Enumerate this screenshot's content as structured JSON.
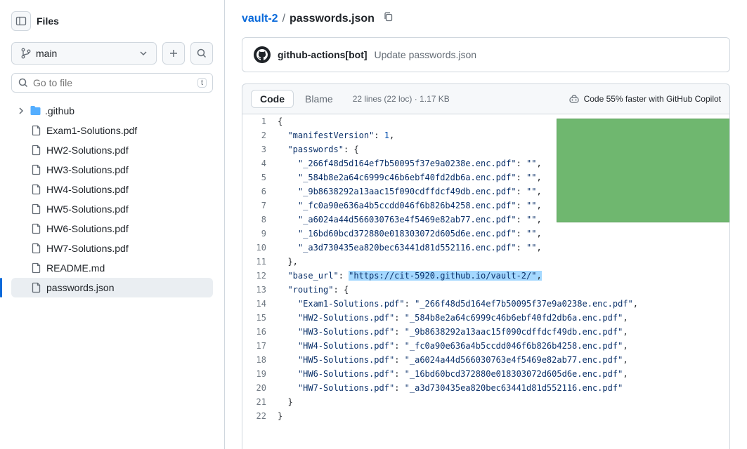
{
  "sidebar": {
    "title": "Files",
    "branch": "main",
    "searchPlaceholder": "Go to file",
    "searchKbd": "t",
    "tree": {
      "folder": ".github",
      "files": [
        "Exam1-Solutions.pdf",
        "HW2-Solutions.pdf",
        "HW3-Solutions.pdf",
        "HW4-Solutions.pdf",
        "HW5-Solutions.pdf",
        "HW6-Solutions.pdf",
        "HW7-Solutions.pdf",
        "README.md",
        "passwords.json"
      ],
      "selected": "passwords.json"
    }
  },
  "breadcrumb": {
    "repo": "vault-2",
    "file": "passwords.json"
  },
  "commit": {
    "author": "github-actions[bot]",
    "message": "Update passwords.json"
  },
  "toolbar": {
    "codeTab": "Code",
    "blameTab": "Blame",
    "meta": "22 lines (22 loc) · 1.17 KB",
    "copilot": "Code 55% faster with GitHub Copilot"
  },
  "code": {
    "manifestVersion": 1,
    "base_url": "https://cit-5920.github.io/vault-2/",
    "passwords": [
      {
        "key": "_266f48d5d164ef7b50095f37e9a0238e.enc.pdf",
        "val": ""
      },
      {
        "key": "_584b8e2a64c6999c46b6ebf40fd2db6a.enc.pdf",
        "val": ""
      },
      {
        "key": "_9b8638292a13aac15f090cdffdcf49db.enc.pdf",
        "val": ""
      },
      {
        "key": "_fc0a90e636a4b5ccdd046f6b826b4258.enc.pdf",
        "val": ""
      },
      {
        "key": "_a6024a44d566030763e4f5469e82ab77.enc.pdf",
        "val": ""
      },
      {
        "key": "_16bd60bcd372880e018303072d605d6e.enc.pdf",
        "val": ""
      },
      {
        "key": "_a3d730435ea820bec63441d81d552116.enc.pdf",
        "val": ""
      }
    ],
    "routing": [
      {
        "key": "Exam1-Solutions.pdf",
        "val": "_266f48d5d164ef7b50095f37e9a0238e.enc.pdf"
      },
      {
        "key": "HW2-Solutions.pdf",
        "val": "_584b8e2a64c6999c46b6ebf40fd2db6a.enc.pdf"
      },
      {
        "key": "HW3-Solutions.pdf",
        "val": "_9b8638292a13aac15f090cdffdcf49db.enc.pdf"
      },
      {
        "key": "HW4-Solutions.pdf",
        "val": "_fc0a90e636a4b5ccdd046f6b826b4258.enc.pdf"
      },
      {
        "key": "HW5-Solutions.pdf",
        "val": "_a6024a44d566030763e4f5469e82ab77.enc.pdf"
      },
      {
        "key": "HW6-Solutions.pdf",
        "val": "_16bd60bcd372880e018303072d605d6e.enc.pdf"
      },
      {
        "key": "HW7-Solutions.pdf",
        "val": "_a3d730435ea820bec63441d81d552116.enc.pdf"
      }
    ]
  }
}
